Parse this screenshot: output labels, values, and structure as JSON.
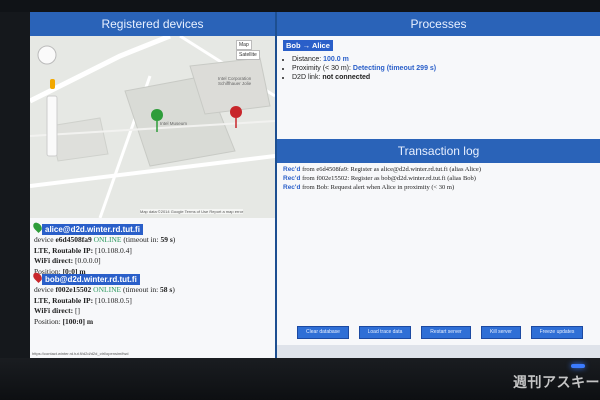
{
  "left_panel": {
    "title": "Registered devices",
    "map": {
      "mode_map": "Map",
      "mode_satellite": "Satellite",
      "label_place": "Intel Corporation Schiffhauer Jolie",
      "label_museum": "Intel Museum",
      "attribution": "Map data ©2014 Google  Terms of Use  Report a map error"
    },
    "devices": [
      {
        "name": "alice@d2d.winter.rd.tut.fi",
        "pin_color": "#2e9d3a",
        "device_prefix": "device",
        "device_id": "e6d4508fa9",
        "online": "ONLINE",
        "timeout_label": "(timeout in:",
        "timeout": "59 s",
        "network": "LTE, Routable IP:",
        "ip": "[10.108.0.4]",
        "wifi_label": "WiFi direct:",
        "wifi": "[0.0.0.0]",
        "position_label": "Position:",
        "position": "[0:0] m"
      },
      {
        "name": "bob@d2d.winter.rd.tut.fi",
        "pin_color": "#c8262b",
        "device_prefix": "device",
        "device_id": "f002e15502",
        "online": "ONLINE",
        "timeout_label": "(timeout in:",
        "timeout": "58 s",
        "network": "LTE, Routable IP:",
        "ip": "[10.108.0.5]",
        "wifi_label": "WiFi direct:",
        "wifi": "[]",
        "position_label": "Position:",
        "position": "[100:0] m"
      }
    ],
    "status_url": "https://contact.winter.rd.tut.fi/d2d/d2d_ctrl/opensim/fwd"
  },
  "processes": {
    "title": "Processes",
    "pair": "Bob → Alice",
    "distance_label": "Distance:",
    "distance": "100.0 m",
    "proximity_label": "Proximity (< 30 m):",
    "proximity": "Detecting (timeout 299 s)",
    "d2d_label": "D2D link:",
    "d2d": "not connected"
  },
  "transaction_log": {
    "title": "Transaction log",
    "entries": [
      {
        "rec": "Rec'd",
        "text": " from e6d4508fa9: Register as alice@d2d.winter.rd.tut.fi (alias Alice)"
      },
      {
        "rec": "Rec'd",
        "text": " from f002e15502: Register as bob@d2d.winter.rd.tut.fi (alias Bob)"
      },
      {
        "rec": "Rec'd",
        "text": " from Bob: Request alert when Alice in proximity (< 30 m)"
      }
    ]
  },
  "buttons": {
    "clear_database": "Clear database",
    "load_trace": "Load trace data",
    "restart_server": "Restart server",
    "kill_server": "Kill server",
    "freeze_updates": "Freeze updates"
  },
  "watermark": "週刊アスキー"
}
